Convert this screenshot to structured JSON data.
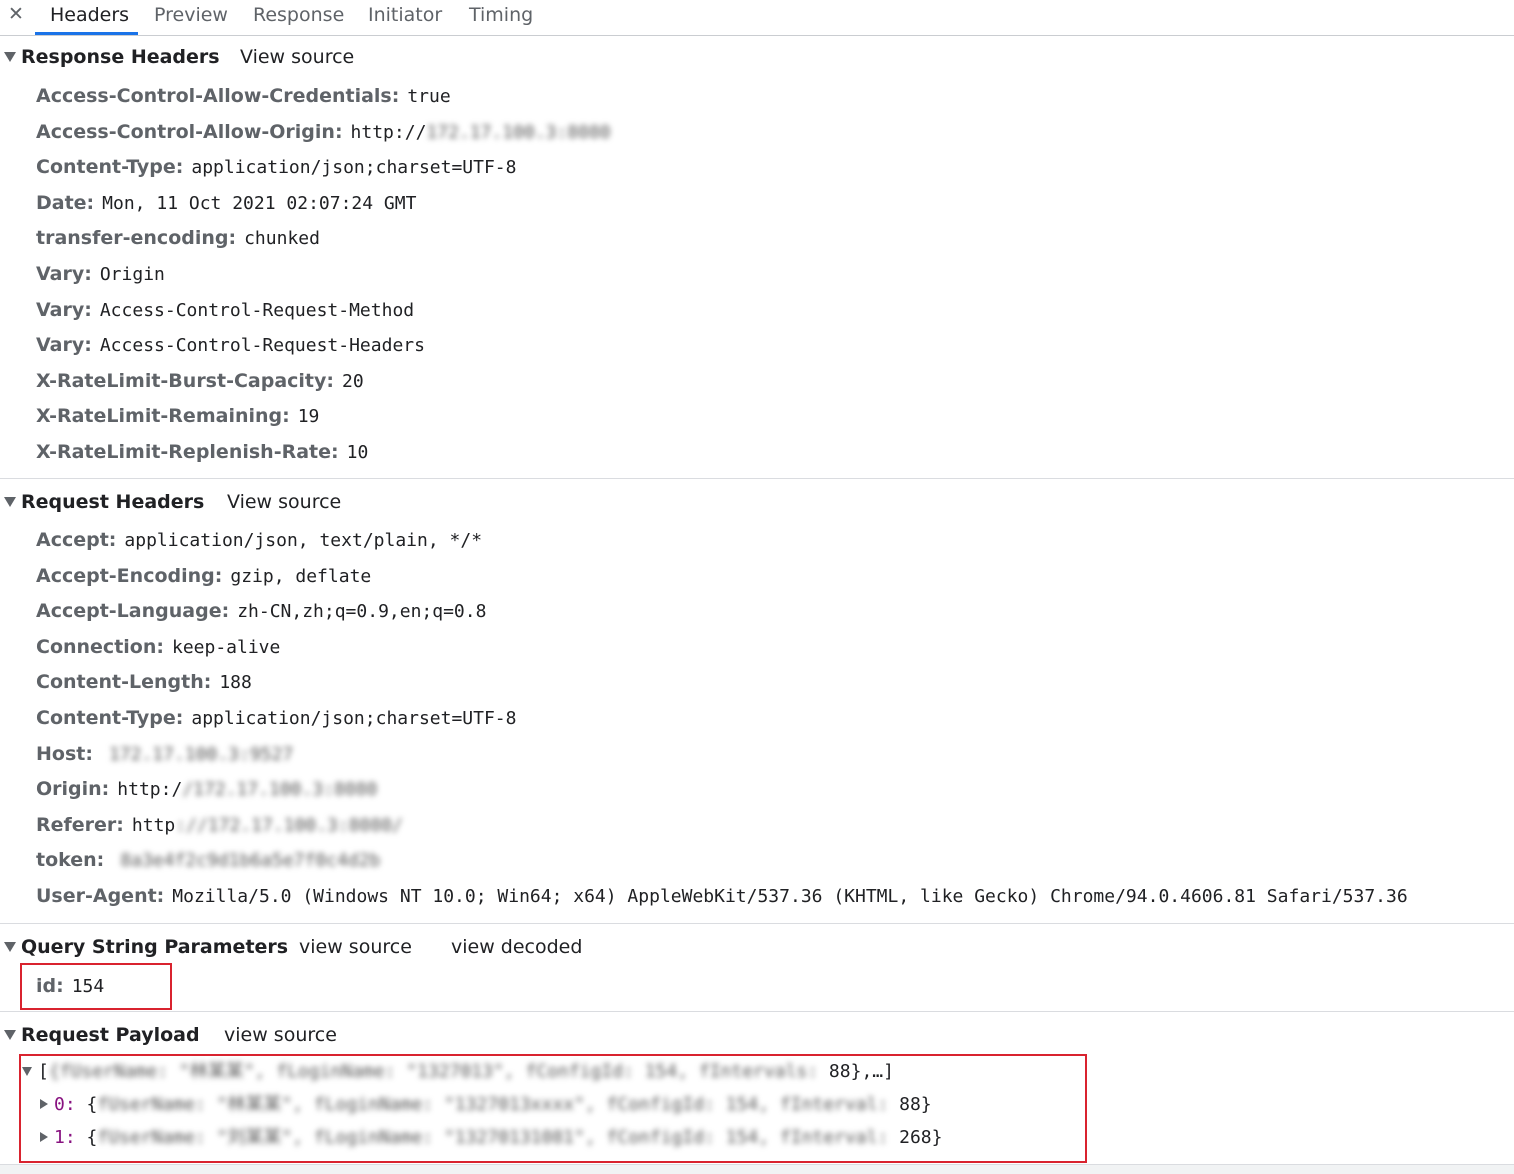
{
  "tabs": {
    "close": "✕",
    "items": [
      "Headers",
      "Preview",
      "Response",
      "Initiator",
      "Timing"
    ]
  },
  "response_headers": {
    "title": "Response Headers",
    "view_source": "View source",
    "items": [
      {
        "name": "Access-Control-Allow-Credentials:",
        "value": "true"
      },
      {
        "name": "Access-Control-Allow-Origin:",
        "value": "http://",
        "blur": "172.17.100.3:8080"
      },
      {
        "name": "Content-Type:",
        "value": "application/json;charset=UTF-8"
      },
      {
        "name": "Date:",
        "value": "Mon, 11 Oct 2021 02:07:24 GMT"
      },
      {
        "name": "transfer-encoding:",
        "value": "chunked"
      },
      {
        "name": "Vary:",
        "value": "Origin"
      },
      {
        "name": "Vary:",
        "value": "Access-Control-Request-Method"
      },
      {
        "name": "Vary:",
        "value": "Access-Control-Request-Headers"
      },
      {
        "name": "X-RateLimit-Burst-Capacity:",
        "value": "20"
      },
      {
        "name": "X-RateLimit-Remaining:",
        "value": "19"
      },
      {
        "name": "X-RateLimit-Replenish-Rate:",
        "value": "10"
      }
    ]
  },
  "request_headers": {
    "title": "Request Headers",
    "view_source": "View source",
    "items": [
      {
        "name": "Accept:",
        "value": "application/json, text/plain, */*"
      },
      {
        "name": "Accept-Encoding:",
        "value": "gzip, deflate"
      },
      {
        "name": "Accept-Language:",
        "value": "zh-CN,zh;q=0.9,en;q=0.8"
      },
      {
        "name": "Connection:",
        "value": "keep-alive"
      },
      {
        "name": "Content-Length:",
        "value": "188"
      },
      {
        "name": "Content-Type:",
        "value": "application/json;charset=UTF-8"
      },
      {
        "name": "Host:",
        "value": "",
        "blur": "172.17.100.3:9527"
      },
      {
        "name": "Origin:",
        "value": "http:/",
        "blur": "/172.17.100.3:8080"
      },
      {
        "name": "Referer:",
        "value": "http",
        "blur": "://172.17.100.3:8080/"
      },
      {
        "name": "token:",
        "value": "",
        "blur": "8a3e4f2c9d1b6a5e7f0c4d2b"
      },
      {
        "name": "User-Agent:",
        "value": "Mozilla/5.0 (Windows NT 10.0; Win64; x64) AppleWebKit/537.36 (KHTML, like Gecko) Chrome/94.0.4606.81 Safari/537.36"
      }
    ]
  },
  "query_params": {
    "title": "Query String Parameters",
    "view_source": "view source",
    "view_decoded": "view decoded",
    "items": [
      {
        "name": "id:",
        "value": "154"
      }
    ]
  },
  "payload": {
    "title": "Request Payload",
    "view_source": "view source",
    "root_prefix": "[",
    "root_blur": "{fUserName: \"林某某\", fLoginName: \"1327013\", fConfigId: 154, fIntervals:",
    "root_suffix": " 88},…]",
    "items": [
      {
        "index": "0:",
        "open": " {",
        "blur": "fUserName: \"林某某\", fLoginName: \"1327013xxxx\", fConfigId: 154, fInterval: ",
        "close": "88}"
      },
      {
        "index": "1:",
        "open": " {",
        "blur": "fUserName: \"刘某某\", fLoginName: \"13270131081\", fConfigId: 154, fInterval:",
        "close": " 268}"
      }
    ]
  }
}
